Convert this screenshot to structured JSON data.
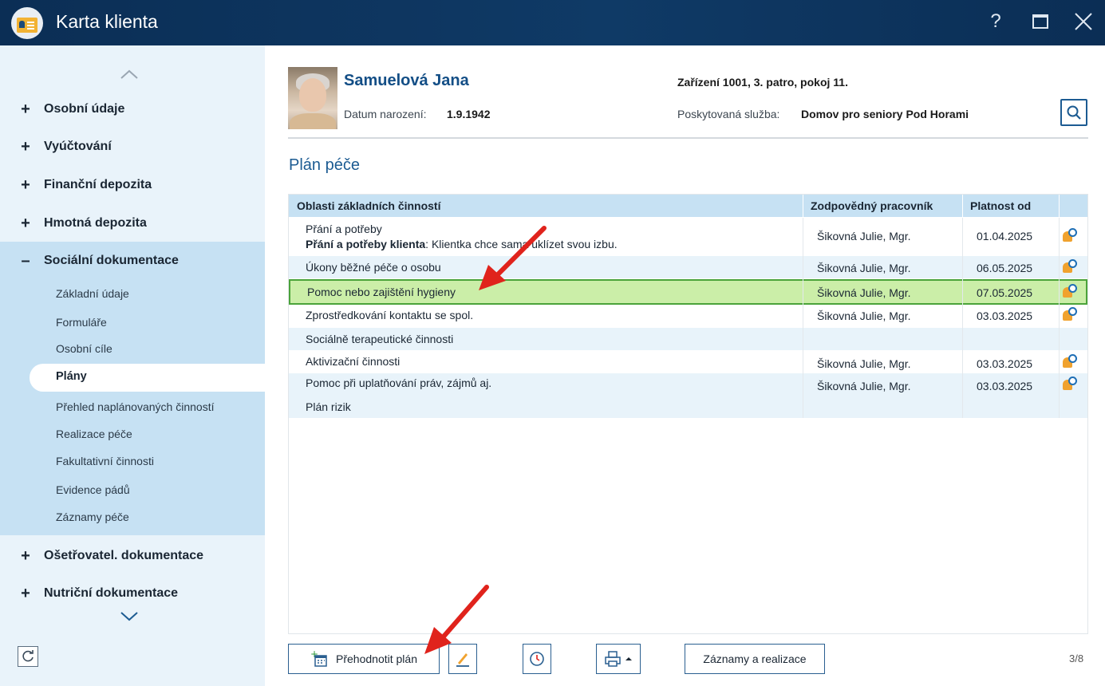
{
  "window": {
    "title": "Karta klienta",
    "help_label": "?"
  },
  "sidebar": {
    "items": [
      {
        "label": "Osobní údaje",
        "sign": "+"
      },
      {
        "label": "Vyúčtování",
        "sign": "+"
      },
      {
        "label": "Finanční depozita",
        "sign": "+"
      },
      {
        "label": "Hmotná depozita",
        "sign": "+"
      },
      {
        "label": "Sociální dokumentace",
        "sign": "–"
      },
      {
        "label": "Ošetřovatel. dokumentace",
        "sign": "+"
      },
      {
        "label": "Nutriční dokumentace",
        "sign": "+"
      }
    ],
    "subitems": [
      "Základní údaje",
      "Formuláře",
      "Osobní cíle",
      "Plány",
      "Přehled naplánovaných činností",
      "Realizace péče",
      "Fakultativní činnosti",
      "Evidence pádů",
      "Záznamy péče"
    ],
    "active_subitem": "Plány"
  },
  "client": {
    "name": "Samuelová Jana",
    "dob_label": "Datum narození:",
    "dob": "1.9.1942",
    "location": "Zařízení 1001, 3. patro, pokoj 11.",
    "service_label": "Poskytovaná služba:",
    "service": "Domov pro seniory Pod Horami"
  },
  "main": {
    "title": "Plán péče",
    "table": {
      "headers": [
        "Oblasti základních činností",
        "Zodpovědný pracovník",
        "Platnost od"
      ],
      "rows": [
        {
          "area": "Přání a potřeby",
          "detail_label": "Přání a potřeby klienta",
          "detail_text": ": Klientka chce sama uklízet svou izbu.",
          "worker": "Šikovná Julie, Mgr.",
          "date": "01.04.2025",
          "bell": true
        },
        {
          "area": "Úkony běžné péče o osobu",
          "worker": "Šikovná Julie, Mgr.",
          "date": "06.05.2025",
          "bell": true
        },
        {
          "area": "Pomoc nebo zajištění hygieny",
          "worker": "Šikovná Julie, Mgr.",
          "date": "07.05.2025",
          "bell": true,
          "selected": true
        },
        {
          "area": "Zprostředkování kontaktu se spol.",
          "worker": "Šikovná Julie, Mgr.",
          "date": "03.03.2025",
          "bell": true
        },
        {
          "area": "Sociálně terapeutické činnosti",
          "worker": "",
          "date": "",
          "bell": false
        },
        {
          "area": "Aktivizační činnosti",
          "worker": "Šikovná Julie, Mgr.",
          "date": "03.03.2025",
          "bell": true
        },
        {
          "area": "Pomoc při uplatňování práv, zájmů aj.",
          "worker": "Šikovná Julie, Mgr.",
          "date": "03.03.2025",
          "bell": true
        },
        {
          "area": "Plán rizik",
          "worker": "",
          "date": "",
          "bell": false
        }
      ]
    }
  },
  "footer": {
    "reevaluate_label": "Přehodnotit plán",
    "records_label": "Záznamy a realizace",
    "pager": "3/8"
  },
  "colors": {
    "accent": "#1c5b92",
    "titlebar": "#0f3a66",
    "selection": "#cbeea8",
    "annotation_arrow": "#e0231c"
  }
}
